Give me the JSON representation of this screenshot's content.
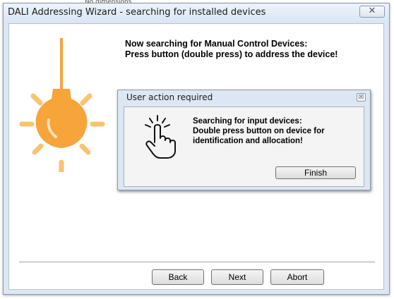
{
  "window": {
    "title": "DALI Addressing Wizard - searching for installed devices",
    "close_glyph": "✕"
  },
  "background": {
    "partial_text": "No dimensions"
  },
  "main": {
    "instruction_line1": "Now searching for Manual Control Devices:",
    "instruction_line2": "Press button (double press) to address the device!"
  },
  "buttons": {
    "back": "Back",
    "next": "Next",
    "abort": "Abort"
  },
  "dialog": {
    "title": "User action required",
    "close_glyph": "☒",
    "line1": "Searching for input devices:",
    "line2": "Double press button on device for",
    "line3": "identification and allocation!",
    "finish_label": "Finish"
  },
  "icons": {
    "bulb": "light-bulb-icon",
    "hand": "press-button-hand-icon"
  },
  "colors": {
    "bulb_orange": "#f7a43a",
    "bulb_glow": "#fcd59a",
    "window_frame": "#dde7f3"
  }
}
